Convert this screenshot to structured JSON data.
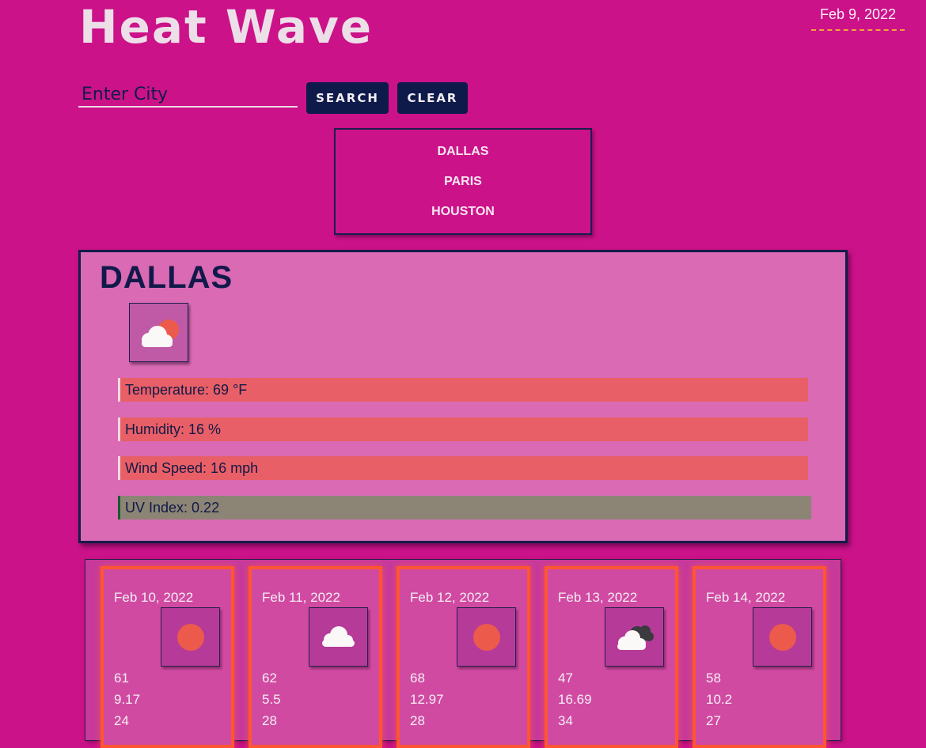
{
  "header": {
    "title": "Heat Wave",
    "date": "Feb 9, 2022"
  },
  "search": {
    "placeholder": "Enter City",
    "value": "",
    "search_label": "SEARCH",
    "clear_label": "CLEAR"
  },
  "history": [
    "DALLAS",
    "PARIS",
    "HOUSTON"
  ],
  "current": {
    "city": "DALLAS",
    "icon": "few-clouds-icon",
    "temperature": "Temperature: 69 °F",
    "humidity": "Humidity: 16 %",
    "wind": "Wind Speed: 16 mph",
    "uv": "UV Index: 0.22"
  },
  "forecast": [
    {
      "date": "Feb 10, 2022",
      "icon": "sun-icon",
      "temp": "61",
      "wind": "9.17",
      "humidity": "24"
    },
    {
      "date": "Feb 11, 2022",
      "icon": "cloud-icon",
      "temp": "62",
      "wind": "5.5",
      "humidity": "28"
    },
    {
      "date": "Feb 12, 2022",
      "icon": "sun-icon",
      "temp": "68",
      "wind": "12.97",
      "humidity": "28"
    },
    {
      "date": "Feb 13, 2022",
      "icon": "broken-clouds-icon",
      "temp": "47",
      "wind": "16.69",
      "humidity": "34"
    },
    {
      "date": "Feb 14, 2022",
      "icon": "sun-icon",
      "temp": "58",
      "wind": "10.2",
      "humidity": "27"
    }
  ],
  "colors": {
    "background": "#cc1289",
    "accent_navy": "#0e1a4a",
    "stat_bar": "#e95f67",
    "uv_bar": "#8c8475",
    "forecast_border": "#ff5533",
    "date_underline": "#f5a33a"
  }
}
